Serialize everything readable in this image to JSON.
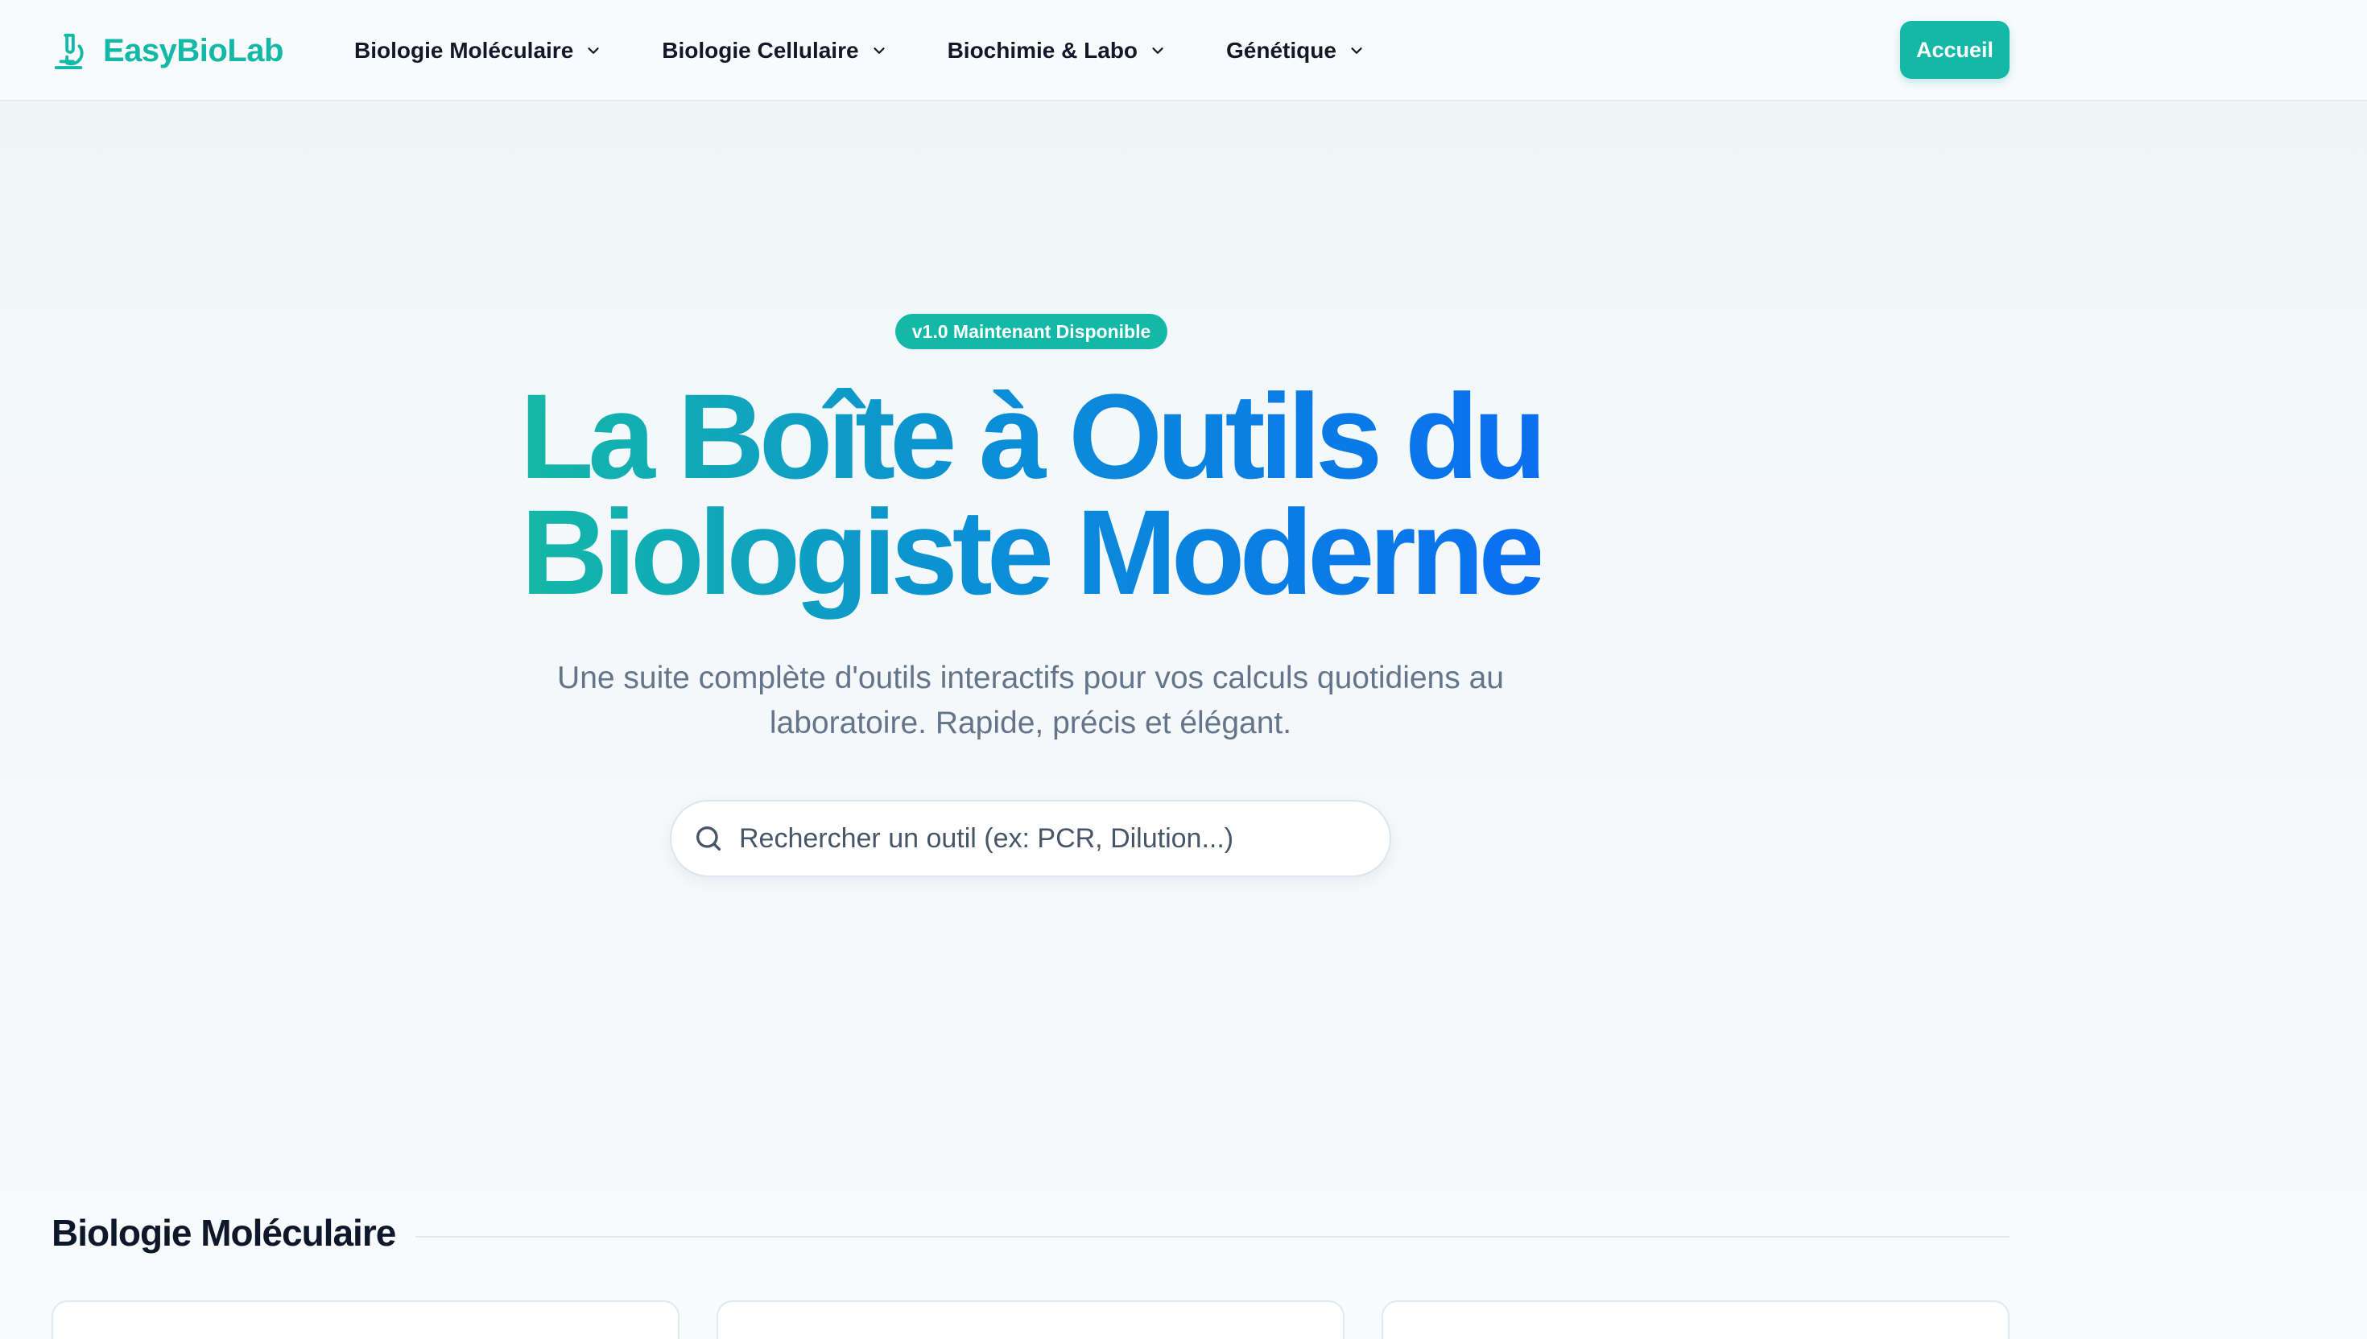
{
  "brand": {
    "name": "EasyBioLab",
    "icon": "microscope-icon",
    "color": "#14b8a6"
  },
  "nav": {
    "items": [
      {
        "label": "Biologie Moléculaire",
        "icon": "chevron-down-icon"
      },
      {
        "label": "Biologie Cellulaire",
        "icon": "chevron-down-icon"
      },
      {
        "label": "Biochimie & Labo",
        "icon": "chevron-down-icon"
      },
      {
        "label": "Génétique",
        "icon": "chevron-down-icon"
      }
    ],
    "home_label": "Accueil"
  },
  "hero": {
    "badge": "v1.0 Maintenant Disponible",
    "title_line1": "La Boîte à Outils du",
    "title_line2": "Biologiste Moderne",
    "subtitle_line1": "Une suite complète d'outils interactifs pour vos calculs quotidiens au",
    "subtitle_line2": "laboratoire. Rapide, précis et élégant.",
    "accent_from": "#14b8a6",
    "accent_to": "#0a6ff0"
  },
  "search": {
    "placeholder": "Rechercher un outil (ex: PCR, Dilution...)",
    "value": "",
    "icon": "search-icon"
  },
  "section": {
    "title": "Biologie Moléculaire"
  }
}
